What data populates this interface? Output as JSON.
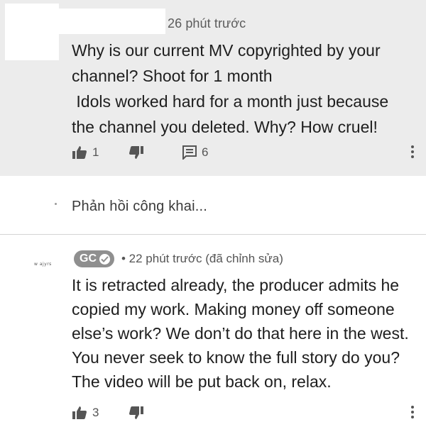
{
  "comment": {
    "timestamp": "26 phút trước",
    "body_lines": [
      "Why is our current MV copyrighted by your",
      "channel? Shoot for 1 month",
      " Idols worked hard for a month just because",
      "the channel you deleted. Why? How cruel!"
    ],
    "like_count": "1",
    "reply_count": "6"
  },
  "reply_box": {
    "placeholder": "Phản hồi công khai..."
  },
  "reply": {
    "author": "GC",
    "avatar_text": "w ajyrs",
    "meta": "• 22 phút trước (đã chỉnh sửa)",
    "body_lines": [
      "It is retracted already, the producer admits he",
      "copied my work. Making money off someone",
      "else’s work? We don’t do that here in the west.",
      "You never seek to know the full story do you?",
      "The video will be put back on, relax."
    ],
    "like_count": "3"
  },
  "colors": {
    "comment_background": "#ececec",
    "author_chip": "#8f8f8f",
    "icon": "#555555"
  }
}
